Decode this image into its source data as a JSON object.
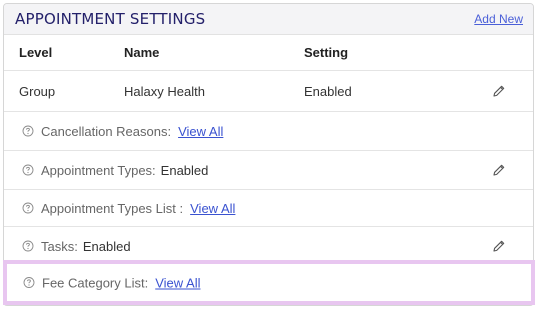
{
  "panel": {
    "title": "APPOINTMENT SETTINGS",
    "add_new_label": "Add New"
  },
  "table": {
    "headers": {
      "level": "Level",
      "name": "Name",
      "setting": "Setting"
    },
    "rows": [
      {
        "level": "Group",
        "name": "Halaxy Health",
        "setting": "Enabled"
      }
    ]
  },
  "info_rows": [
    {
      "label": "Cancellation Reasons:",
      "link": "View All"
    },
    {
      "label": "Appointment Types:",
      "value": "Enabled"
    },
    {
      "label": "Appointment Types List :",
      "link": "View All"
    },
    {
      "label": "Tasks:",
      "value": "Enabled"
    },
    {
      "label": "Fee Category List:",
      "link": "View All"
    }
  ],
  "colors": {
    "title": "#23206a",
    "link": "#3a52d0",
    "highlight_border": "#e8c6f0"
  }
}
